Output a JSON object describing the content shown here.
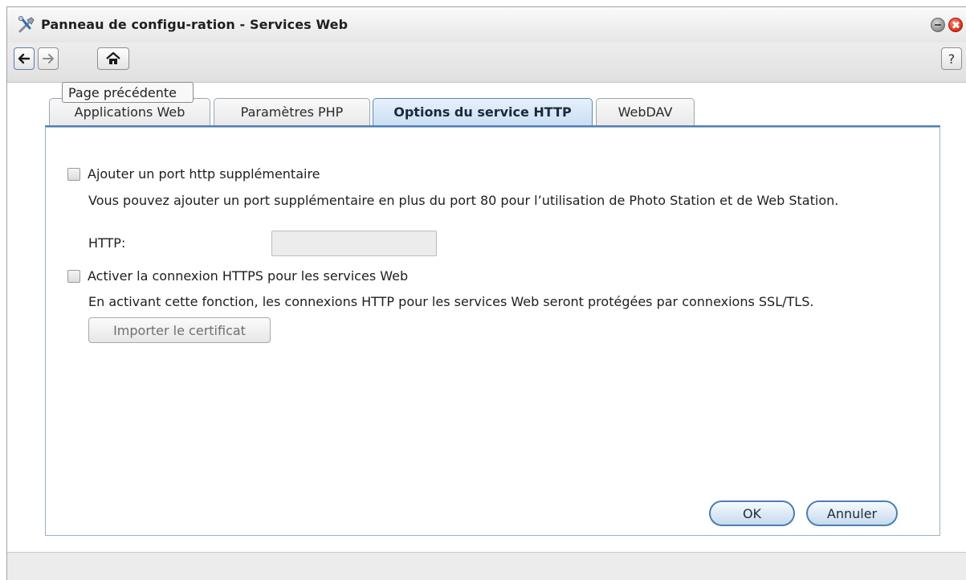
{
  "window": {
    "title": "Panneau de configu-ration - Services Web",
    "icon": "tools-icon"
  },
  "toolbar": {
    "back_icon": "arrow-left-icon",
    "forward_icon": "arrow-right-icon",
    "home_icon": "home-icon",
    "help_label": "?",
    "tooltip": "Page précédente"
  },
  "tabs": [
    {
      "label": "Applications Web",
      "active": false
    },
    {
      "label": "Paramètres PHP",
      "active": false
    },
    {
      "label": "Options du service HTTP",
      "active": true
    },
    {
      "label": "WebDAV",
      "active": false
    }
  ],
  "form": {
    "extra_port": {
      "label": "Ajouter un port http supplémentaire",
      "checked": false,
      "description": "Vous pouvez ajouter un port supplémentaire en plus du port 80 pour l’utilisation de Photo Station et de Web Station.",
      "http_label": "HTTP:",
      "http_value": ""
    },
    "https": {
      "label": "Activer la connexion HTTPS pour les services Web",
      "checked": false,
      "description": "En activant cette fonction, les connexions HTTP pour les services Web seront protégées par connexions SSL/TLS.",
      "import_button": "Importer le certificat"
    }
  },
  "actions": {
    "ok": "OK",
    "cancel": "Annuler"
  },
  "colors": {
    "accent": "#4f80b3",
    "close_button": "#e0301e"
  }
}
